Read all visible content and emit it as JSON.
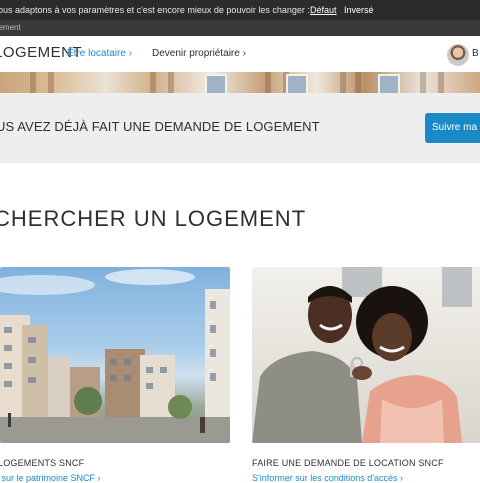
{
  "contrast_bar": {
    "message": "ous adaptons à vos paramètres et c'est encore mieux de pouvoir les changer :",
    "options": [
      "Défaut",
      "Inversé"
    ]
  },
  "breadcrumb": {
    "text": "gement"
  },
  "header": {
    "logo": "LOGEMENT",
    "nav": [
      "Être locataire ›",
      "Devenir propriétaire ›"
    ],
    "user_initial": "B"
  },
  "notice": {
    "text": "US AVEZ DÉJÀ FAIT UNE DEMANDE DE LOGEMENT",
    "button": "Suivre ma de"
  },
  "section": {
    "title": "CHERCHER UN LOGEMENT"
  },
  "cards": [
    {
      "caption": "LOGEMENTS SNCF",
      "link": "ir sur le patrimoine SNCF ›"
    },
    {
      "caption": "FAIRE UNE DEMANDE DE LOCATION SNCF",
      "link": "S'informer sur les conditions d'accès ›"
    }
  ],
  "colors": {
    "accent": "#1a8ac7",
    "dark_bar": "#2b2b2b",
    "notice_bg": "#eeeeee"
  }
}
